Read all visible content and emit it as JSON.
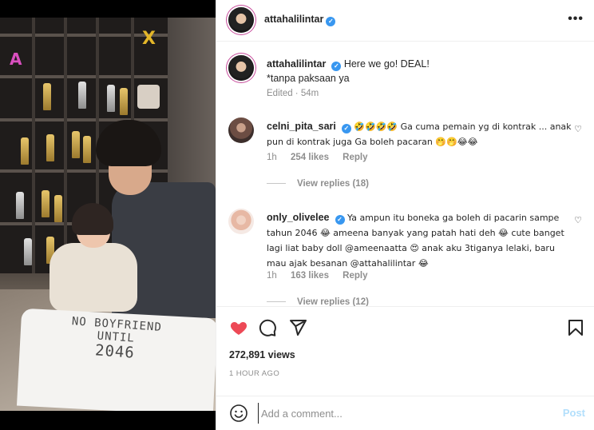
{
  "header": {
    "username": "attahalilintar",
    "verified_mark": "✓",
    "more_label": "•••"
  },
  "caption": {
    "username": "attahalilintar",
    "line1": "Here we go! DEAL!",
    "line2": "*tanpa paksaan ya",
    "edited": "Edited · 54m"
  },
  "comments": [
    {
      "username": "celni_pita_sari",
      "text": "🤣🤣🤣🤣 Ga cuma pemain yg di kontrak ... anak pun di kontrak juga Ga boleh pacaran 🤭🤭😂😂",
      "time": "1h",
      "likes": "254 likes",
      "reply": "Reply",
      "view_replies": "View replies (18)"
    },
    {
      "username": "only_olivelee",
      "text": "Ya ampun itu boneka ga boleh di pacarin sampe tahun 2046 😂 ameena banyak yang patah hati deh 😂 cute banget lagi liat baby doll @ameenaatta 😍 anak aku 3tiganya lelaki, baru mau ajak besanan @attahalilintar 😂",
      "time": "1h",
      "likes": "163 likes",
      "reply": "Reply",
      "view_replies": "View replies (12)"
    }
  ],
  "actions": {
    "like_icon": "heart-icon",
    "comment_icon": "comment-icon",
    "share_icon": "send-icon",
    "save_icon": "bookmark-icon",
    "views": "272,891 views",
    "posted": "1 HOUR AGO",
    "liked_color": "#ed4956"
  },
  "composer": {
    "placeholder": "Add a comment...",
    "post_label": "Post",
    "emoji_icon": "smiley-icon"
  },
  "media": {
    "shirt_line1": "NO BOYFRIEND",
    "shirt_line2": "UNTIL",
    "shirt_line3": "2046"
  }
}
